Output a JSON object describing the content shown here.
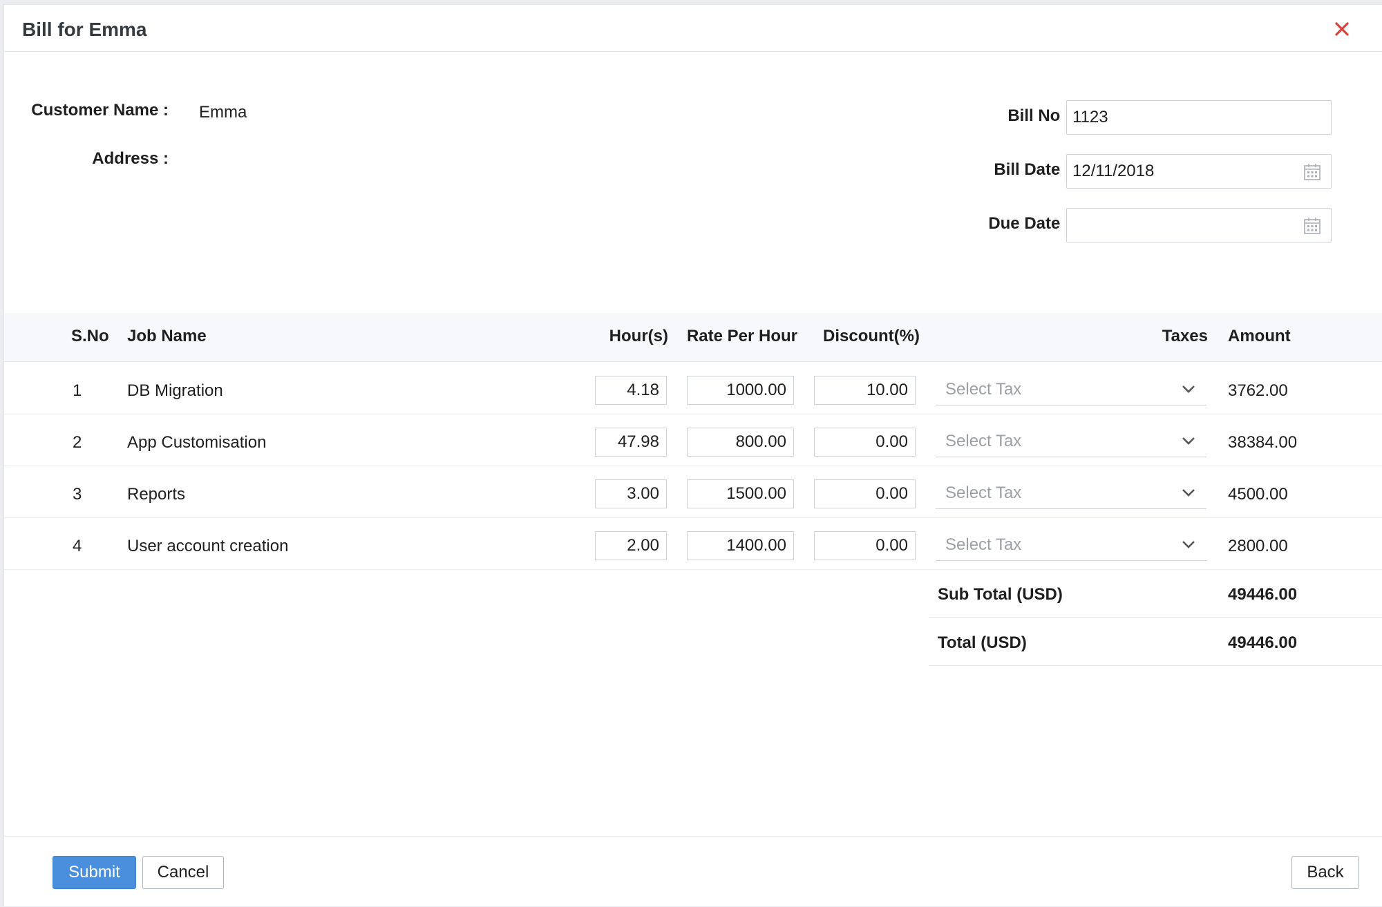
{
  "dialog": {
    "title": "Bill for Emma",
    "close_icon": "close-icon"
  },
  "customer": {
    "name_label": "Customer Name :",
    "name_value": "Emma",
    "address_label": "Address :",
    "address_value": ""
  },
  "bill": {
    "bill_no_label": "Bill No :",
    "bill_no_value": "1123",
    "bill_date_label": "Bill Date :",
    "bill_date_value": "12/11/2018",
    "due_date_label": "Due Date :",
    "due_date_value": "",
    "calendar_icon": "calendar-icon"
  },
  "table": {
    "headers": {
      "sno": "S.No",
      "job_name": "Job Name",
      "hours": "Hour(s)",
      "rate": "Rate Per Hour",
      "discount": "Discount(%)",
      "taxes": "Taxes",
      "amount": "Amount"
    },
    "rows": [
      {
        "sno": "1",
        "job": "DB Migration",
        "hours": "4.18",
        "rate": "1000.00",
        "discount": "10.00",
        "tax": "Select Tax",
        "amount": "3762.00"
      },
      {
        "sno": "2",
        "job": "App Customisation",
        "hours": "47.98",
        "rate": "800.00",
        "discount": "0.00",
        "tax": "Select Tax",
        "amount": "38384.00"
      },
      {
        "sno": "3",
        "job": "Reports",
        "hours": "3.00",
        "rate": "1500.00",
        "discount": "0.00",
        "tax": "Select Tax",
        "amount": "4500.00"
      },
      {
        "sno": "4",
        "job": "User account creation",
        "hours": "2.00",
        "rate": "1400.00",
        "discount": "0.00",
        "tax": "Select Tax",
        "amount": "2800.00"
      }
    ]
  },
  "summary": {
    "subtotal_label": "Sub Total (USD)",
    "subtotal_value": "49446.00",
    "total_label": "Total (USD)",
    "total_value": "49446.00"
  },
  "footer": {
    "submit_label": "Submit",
    "cancel_label": "Cancel",
    "back_label": "Back"
  },
  "colors": {
    "primary": "#4a8fde",
    "close": "#d9413a",
    "placeholder": "#9aa0a6"
  }
}
